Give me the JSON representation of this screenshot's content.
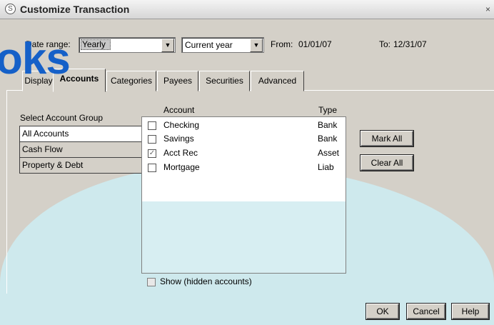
{
  "window": {
    "title": "Customize Transaction",
    "close": "×"
  },
  "filters": {
    "date_range_label": "Date range:",
    "date_range_value": "Yearly",
    "period_value": "Current year",
    "from_label": "From:",
    "from_value": "01/01/07",
    "to_label": "To:",
    "to_value": "12/31/07"
  },
  "watermark": "oks",
  "tabs": [
    {
      "label": "Display"
    },
    {
      "label": "Accounts"
    },
    {
      "label": "Categories"
    },
    {
      "label": "Payees"
    },
    {
      "label": "Securities"
    },
    {
      "label": "Advanced"
    }
  ],
  "account_group": {
    "heading": "Select Account Group",
    "items": [
      "All Accounts",
      "Cash Flow",
      "Property & Debt"
    ]
  },
  "accounts": {
    "col_account": "Account",
    "col_type": "Type",
    "rows": [
      {
        "name": "Checking",
        "type": "Bank",
        "checked": false
      },
      {
        "name": "Savings",
        "type": "Bank",
        "checked": false
      },
      {
        "name": "Acct Rec",
        "type": "Asset",
        "checked": true
      },
      {
        "name": "Mortgage",
        "type": "Liab",
        "checked": false
      }
    ]
  },
  "buttons": {
    "mark_all": "Mark All",
    "clear_all": "Clear All",
    "ok": "OK",
    "cancel": "Cancel",
    "help": "Help"
  },
  "show_hidden": "Show (hidden accounts)",
  "colors": {
    "watermark": "#1560c8",
    "wave": "#cdeaef"
  }
}
